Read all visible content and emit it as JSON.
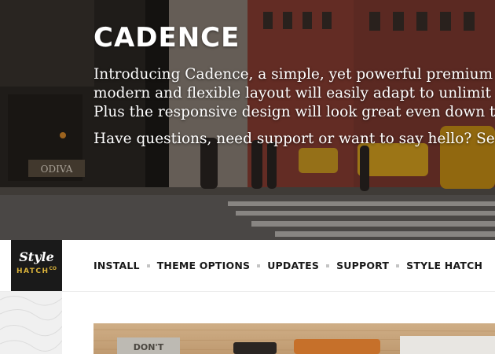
{
  "hero": {
    "title": "CADENCE",
    "lines": [
      "Introducing Cadence, a simple, yet powerful premium",
      "modern and flexible layout will easily adapt to unlimit",
      "Plus the responsive design will look great even down t"
    ],
    "question": "Have questions, need support or want to say hello? Se",
    "storefront_sign": "ODIVA"
  },
  "logo": {
    "line1": "Style",
    "line2": "HATCH",
    "mark": "CO"
  },
  "nav": {
    "items": [
      "INSTALL",
      "THEME OPTIONS",
      "UPDATES",
      "SUPPORT",
      "STYLE HATCH"
    ]
  },
  "colors": {
    "nav_text": "#1a1a1a",
    "logo_bg": "#1a1a1a",
    "logo_accent": "#d9b23a",
    "separator": "#c4c4c4"
  }
}
